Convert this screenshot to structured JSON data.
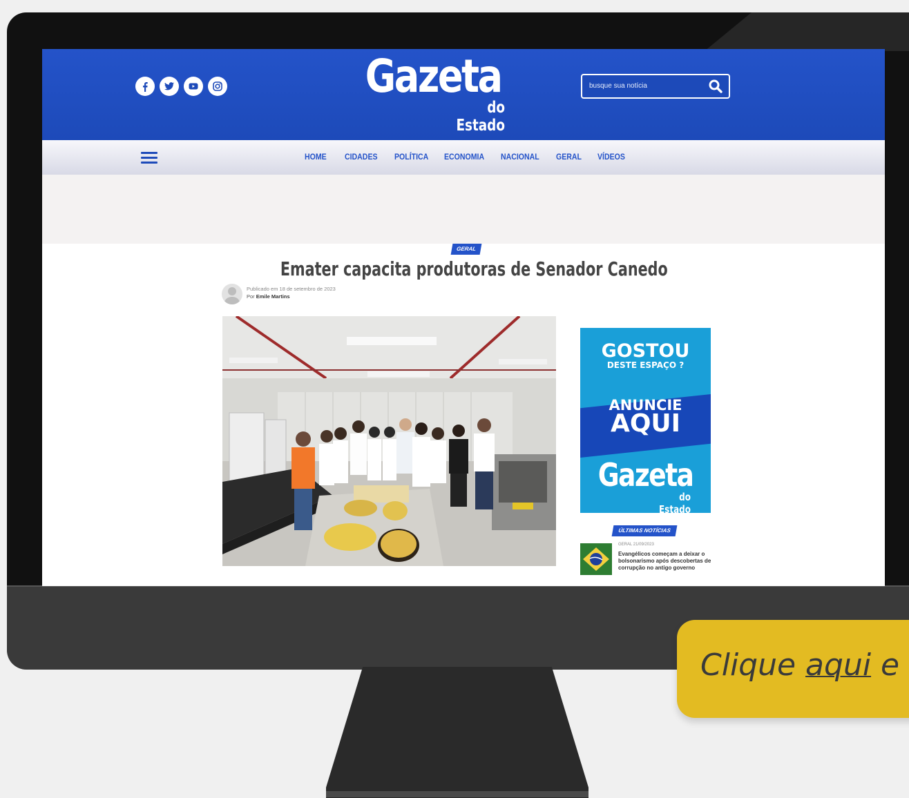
{
  "site": {
    "logo_main": "Gazeta",
    "logo_sub": "do Estado",
    "search_placeholder": "busque sua notícia",
    "social_icons": [
      "facebook-icon",
      "twitter-icon",
      "youtube-icon",
      "instagram-icon"
    ],
    "colors": {
      "brand_blue": "#1d4ab9",
      "nav_text": "#2453c9",
      "callout_yellow": "#e3bb22",
      "ad_cyan": "#1a9fd8"
    }
  },
  "nav": {
    "items": [
      "HOME",
      "CIDADES",
      "POLÍTICA",
      "ECONOMIA",
      "NACIONAL",
      "GERAL",
      "VÍDEOS"
    ]
  },
  "article": {
    "category": "GERAL",
    "title": "Emater capacita produtoras de Senador Canedo",
    "published": "Publicado em 18 de setembro de 2023",
    "author_prefix": "Por",
    "author": "Emile Martins"
  },
  "ad": {
    "line1": "GOSTOU",
    "line2": "DESTE ESPAÇO ?",
    "line3": "ANUNCIE",
    "line4": "AQUI",
    "logo_main": "Gazeta",
    "logo_sub": "do Estado"
  },
  "latest": {
    "heading": "ÚLTIMAS NOTÍCIAS",
    "items": [
      {
        "meta": "GERAL 21/09/2023",
        "title": "Evangélicos começam a deixar o bolsonarismo após descobertas de corrupção no antigo governo"
      }
    ]
  },
  "callout": {
    "prefix": "Clique ",
    "link": "aqui",
    "suffix": " e"
  }
}
